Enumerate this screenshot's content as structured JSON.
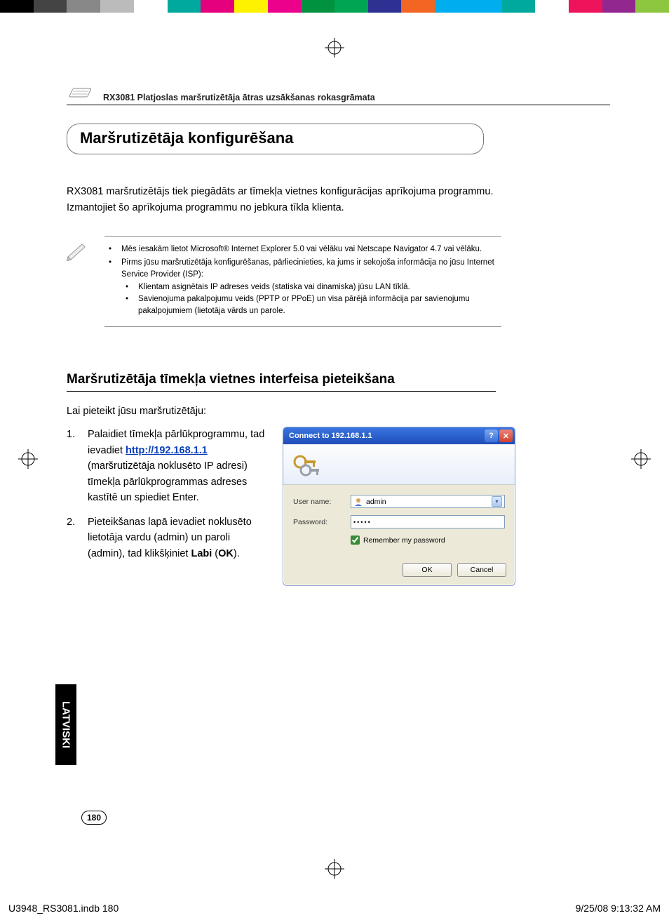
{
  "colorbar": [
    "#000",
    "#444",
    "#888",
    "#bbb",
    "#fff",
    "#00a99d",
    "#e5007e",
    "#fff200",
    "#ec018c",
    "#00923f",
    "#00a551",
    "#2e3192",
    "#f26522",
    "#00aeef",
    "#00adef",
    "#00a99d",
    "#fff",
    "#ed145b",
    "#92278f",
    "#8dc63f"
  ],
  "header": {
    "title": "RX3081 Platjoslas maršrutizētāja ātras uzsākšanas rokasgrāmata"
  },
  "section": {
    "title": "Maršrutizētāja konfigurēšana"
  },
  "intro": "RX3081 maršrutizētājs tiek piegādāts ar tīmekļa vietnes konfigurācijas aprīkojuma programmu. Izmantojiet šo aprīkojuma programmu no jebkura tīkla klienta.",
  "notes": {
    "n1": "Mēs iesakām lietot Microsoft® Internet Explorer 5.0 vai vēlāku vai Netscape Navigator 4.7 vai vēlāku.",
    "n2": "Pirms jūsu maršrutizētāja konfigurēšanas, pārliecinieties, ka jums ir sekojoša informācija no jūsu Internet Service Provider (ISP):",
    "n2a": "Klientam asignētais IP adreses veids (statiska vai dinamiska) jūsu LAN tīklā.",
    "n2b": "Savienojuma pakalpojumu veids (PPTP or PPoE) un visa pārējā informācija par savienojumu pakalpojumiem (lietotāja vārds un parole."
  },
  "h2": "Maršrutizētāja tīmekļa vietnes interfeisa pieteikšana",
  "lead": "Lai pieteikt jūsu maršrutizētāju:",
  "steps": {
    "s1a": "Palaidiet tīmekļa pārlūkprogrammu, tad ievadiet ",
    "s1_link": "http://192.168.1.1",
    "s1b": " (maršrutizētāja noklusēto IP adresi) tīmekļa pārlūkprogrammas adreses kastītē un spiediet Enter.",
    "s2a": "Pieteikšanas lapā ievadiet noklusēto lietotāja vardu (admin) un paroli (admin), tad klikšķiniet ",
    "s2_bold": "Labi",
    "s2b": " (",
    "s2_bold2": "OK",
    "s2c": ")."
  },
  "dialog": {
    "title": "Connect to 192.168.1.1",
    "help": "?",
    "close": "✕",
    "user_label": "User name:",
    "user_value": "admin",
    "pass_label": "Password:",
    "pass_value": "•••••",
    "remember": "Remember my password",
    "ok": "OK",
    "cancel": "Cancel"
  },
  "lang": "LATVISKI",
  "page_number": "180",
  "footer": {
    "left": "U3948_RS3081.indb   180",
    "right": "9/25/08   9:13:32 AM"
  }
}
